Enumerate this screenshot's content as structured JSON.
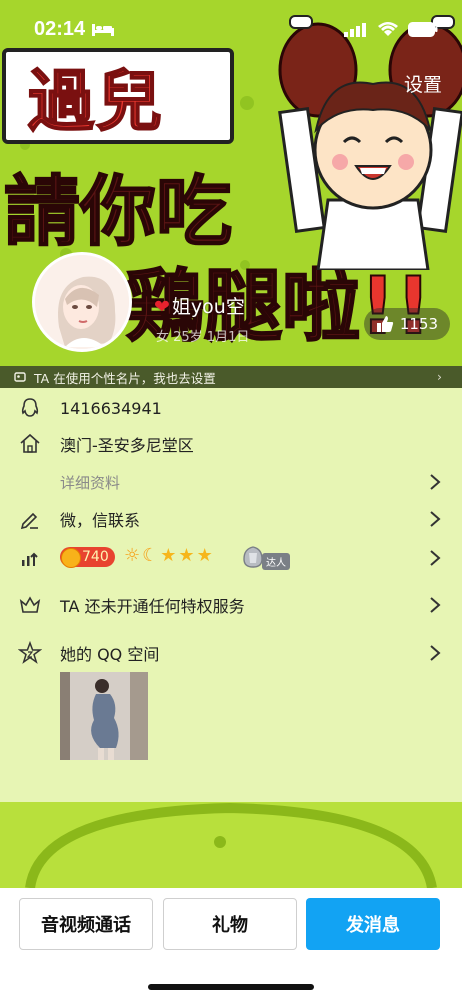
{
  "status_bar": {
    "time": "02:14"
  },
  "header": {
    "settings_label": "设置"
  },
  "cover": {
    "sign_text": "過兒",
    "line2": "請你吃",
    "line3": "鶏腿啦",
    "line3_bang": "!!"
  },
  "profile": {
    "nickname": "姐you空",
    "sub_info": "女  25岁  1月1日",
    "like_count": "1153"
  },
  "card_notice": {
    "text": "TA 在使用个性名片，我也去设置"
  },
  "info_rows": {
    "qq_number": "1416634941",
    "location": "澳门-圣安多尼堂区",
    "detail_link": "详细资料",
    "contact": "微，信联系",
    "level_value": "740",
    "daren_tag": "达人",
    "privilege": "TA 还未开通任何特权服务",
    "qzone": "她的 QQ 空间"
  },
  "actions": {
    "call_label": "音视频通话",
    "gift_label": "礼物",
    "message_label": "发消息"
  },
  "colors": {
    "accent": "#12a3f3",
    "background": "#e7f5b4",
    "cover_green": "#a6d62c",
    "level_badge": "#e8432f"
  },
  "icons": [
    "penguin-icon",
    "home-icon",
    "pencil-icon",
    "trend-icon",
    "crown-icon",
    "star-icon",
    "like-icon",
    "chevron-right-icon",
    "card-icon"
  ]
}
